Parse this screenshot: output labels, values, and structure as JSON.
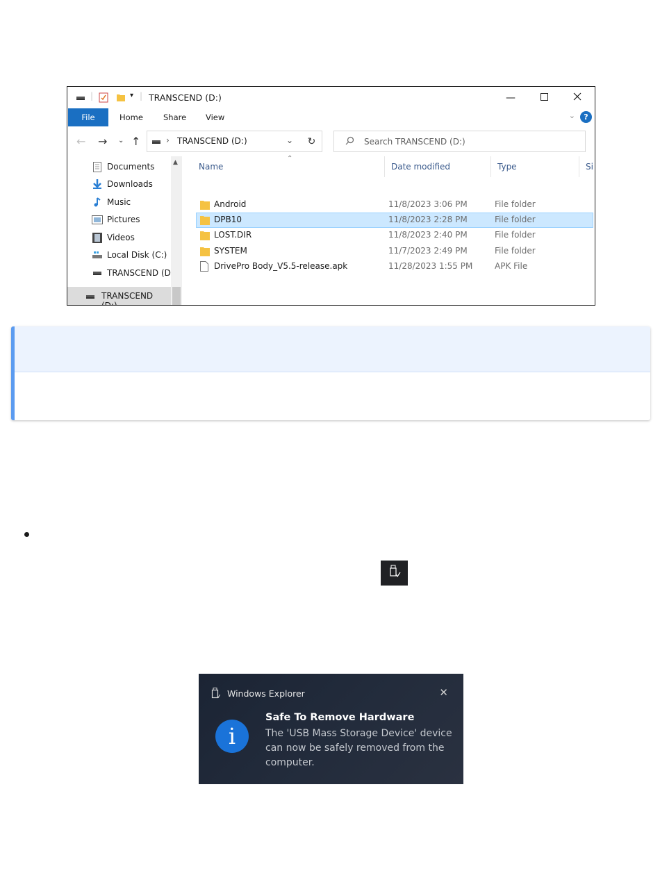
{
  "explorer": {
    "title": "TRANSCEND (D:)",
    "ribbon_tabs": [
      "File",
      "Home",
      "Share",
      "View"
    ],
    "address": "TRANSCEND (D:)",
    "search_placeholder": "Search TRANSCEND (D:)",
    "nav_items": [
      {
        "label": "Documents",
        "icon": "documents-icon"
      },
      {
        "label": "Downloads",
        "icon": "downloads-icon"
      },
      {
        "label": "Music",
        "icon": "music-icon"
      },
      {
        "label": "Pictures",
        "icon": "pictures-icon"
      },
      {
        "label": "Videos",
        "icon": "videos-icon"
      },
      {
        "label": "Local Disk (C:)",
        "icon": "local-disk-icon"
      },
      {
        "label": "TRANSCEND (D:",
        "icon": "drive-icon"
      }
    ],
    "nav_selected": "TRANSCEND (D:)",
    "columns": [
      "Name",
      "Date modified",
      "Type",
      "Si"
    ],
    "files": [
      {
        "name": "Android",
        "date": "11/8/2023 3:06 PM",
        "type": "File folder",
        "kind": "folder"
      },
      {
        "name": "DPB10",
        "date": "11/8/2023 2:28 PM",
        "type": "File folder",
        "kind": "folder",
        "selected": true
      },
      {
        "name": "LOST.DIR",
        "date": "11/8/2023 2:40 PM",
        "type": "File folder",
        "kind": "folder"
      },
      {
        "name": "SYSTEM",
        "date": "11/7/2023 2:49 PM",
        "type": "File folder",
        "kind": "folder"
      },
      {
        "name": "DrivePro Body_V5.5-release.apk",
        "date": "11/28/2023 1:55 PM",
        "type": "APK File",
        "kind": "file"
      }
    ]
  },
  "colors": {
    "ribbon_file": "#1a6fc2",
    "selection": "#cce8ff",
    "callout_accent": "#5b9bf0",
    "toast_bg": "#1f2838",
    "toast_info": "#1a73d9"
  },
  "toast": {
    "app_name": "Windows Explorer",
    "title": "Safe To Remove Hardware",
    "body": "The 'USB Mass Storage Device' device can now be safely removed from the computer."
  }
}
